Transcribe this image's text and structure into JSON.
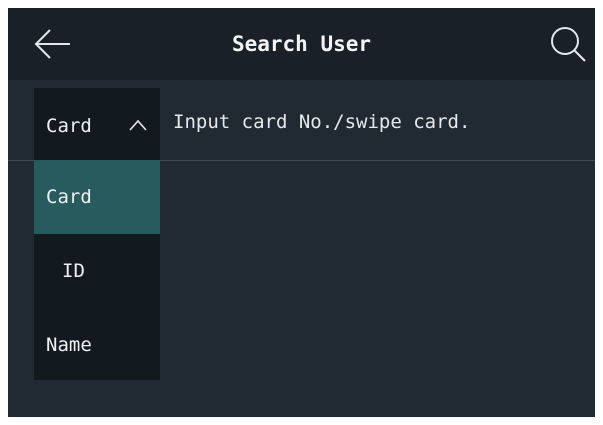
{
  "header": {
    "title": "Search User",
    "back_icon": "arrow-left-icon",
    "search_icon": "search-icon"
  },
  "search": {
    "dropdown": {
      "selected": "Card",
      "expanded": true,
      "chevron_icon": "chevron-up-icon",
      "options": [
        {
          "label": "Card",
          "selected": true
        },
        {
          "label": "ID",
          "selected": false
        },
        {
          "label": "Name",
          "selected": false
        }
      ]
    },
    "input": {
      "value": "",
      "placeholder": "Input card No./swipe card."
    }
  },
  "colors": {
    "background": "#212a33",
    "header": "#1a2028",
    "dropdown": "#131a1f",
    "selected_option": "#285b5e",
    "text": "#eef0f2"
  }
}
